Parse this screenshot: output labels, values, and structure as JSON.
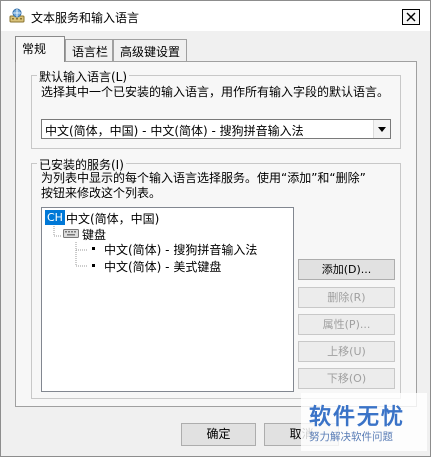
{
  "window": {
    "title": "文本服务和输入语言",
    "icon": "keyboard-globe-icon"
  },
  "tabs": [
    {
      "label": "常规",
      "active": true
    },
    {
      "label": "语言栏",
      "active": false
    },
    {
      "label": "高级键设置",
      "active": false
    }
  ],
  "default_lang": {
    "label": "默认输入语言(L)",
    "desc": "选择其中一个已安装的输入语言，用作所有输入字段的默认语言。",
    "value": "中文(简体，中国) - 中文(简体) - 搜狗拼音输入法"
  },
  "installed": {
    "label": "已安装的服务(I)",
    "desc1": "为列表中显示的每个输入语言选择服务。使用“添加”和“删除”",
    "desc2": "按钮来修改这个列表。",
    "tree": {
      "lang_badge": "CH",
      "lang": "中文(简体，中国)",
      "category": "键盘",
      "services": [
        "中文(简体) - 搜狗拼音输入法",
        "中文(简体) - 美式键盘"
      ]
    }
  },
  "buttons": {
    "add": "添加(D)...",
    "remove": "删除(R)",
    "properties": "属性(P)...",
    "move_up": "上移(U)",
    "move_down": "下移(O)",
    "ok": "确定",
    "cancel": "取消"
  },
  "watermark": {
    "title": "软件无忧",
    "subtitle": "努力解决软件问题"
  },
  "colors": {
    "selection": "#0078d7",
    "watermark": "#3a73c7"
  }
}
